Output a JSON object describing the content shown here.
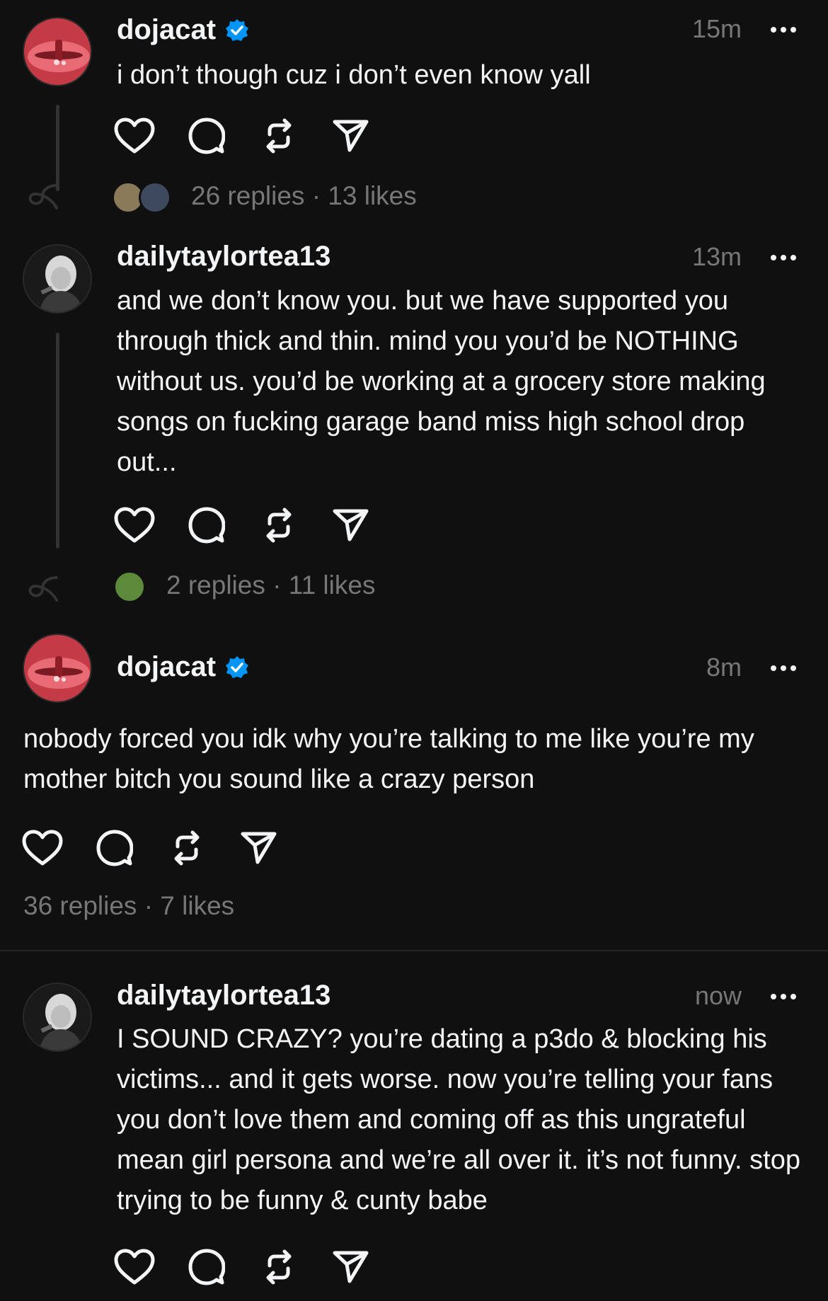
{
  "posts": [
    {
      "username": "dojacat",
      "verified": true,
      "time": "15m",
      "text": "i don’t though cuz i don’t even know yall",
      "stats": "26 replies · 13 likes"
    },
    {
      "username": "dailytaylortea13",
      "verified": false,
      "time": "13m",
      "text": "and we don’t know you. but we have supported you through thick and thin. mind you you’d be NOTHING without us. you’d be working at a grocery store making songs on fucking garage band miss high school drop out...",
      "stats": "2 replies · 11 likes"
    },
    {
      "username": "dojacat",
      "verified": true,
      "time": "8m",
      "text": "nobody forced you idk why you’re talking to me like you’re my mother bitch you sound like a crazy person",
      "stats": "36 replies · 7 likes"
    },
    {
      "username": "dailytaylortea13",
      "verified": false,
      "time": "now",
      "text": "I SOUND CRAZY? you’re dating a p3do & blocking his victims... and it gets worse. now you’re telling your fans you don’t love them and coming off as this ungrateful mean girl persona and we’re all over it. it’s not funny. stop trying to be funny & cunty babe"
    }
  ],
  "icons": {
    "like": "heart-icon",
    "reply": "comment-icon",
    "repost": "repost-icon",
    "share": "send-icon",
    "more": "more-icon",
    "verified": "verified-badge-icon"
  },
  "colors": {
    "background": "#101010",
    "text": "#f3f5f7",
    "muted": "#777777",
    "verified": "#0095f6"
  }
}
